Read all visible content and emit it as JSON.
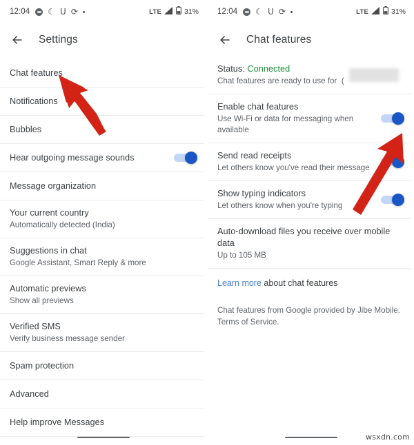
{
  "colors": {
    "accent_blue": "#1a56c4",
    "track_blue": "#c3d6f7",
    "status_green": "#1e8e3e",
    "link_blue": "#4a7fd4",
    "arrow_red": "#d32316",
    "divider": "#ebebeb",
    "text_primary": "#3c4043",
    "text_secondary": "#5f6368"
  },
  "status_bar": {
    "time": "12:04",
    "icons_left": [
      "app-badge-icon",
      "crescent-moon-icon",
      "u-glyph-icon",
      "swirl-icon",
      "dot-icon"
    ],
    "network": "LTE",
    "signal": "signal-bars-icon",
    "battery": "battery-icon",
    "battery_percent": "31%"
  },
  "left_panel": {
    "appbar": {
      "back_icon": "back-arrow-icon",
      "title": "Settings"
    },
    "items": [
      {
        "title": "Chat features",
        "sub": "",
        "toggle": null
      },
      {
        "title": "Notifications",
        "sub": "",
        "toggle": null
      },
      {
        "title": "Bubbles",
        "sub": "",
        "toggle": null
      },
      {
        "title": "Hear outgoing message sounds",
        "sub": "",
        "toggle": "on"
      },
      {
        "title": "Message organization",
        "sub": "",
        "toggle": null
      },
      {
        "title": "Your current country",
        "sub": "Automatically detected (India)",
        "toggle": null
      },
      {
        "title": "Suggestions in chat",
        "sub": "Google Assistant, Smart Reply & more",
        "toggle": null
      },
      {
        "title": "Automatic previews",
        "sub": "Show all previews",
        "toggle": null
      },
      {
        "title": "Verified SMS",
        "sub": "Verify business message sender",
        "toggle": null
      },
      {
        "title": "Spam protection",
        "sub": "",
        "toggle": null
      },
      {
        "title": "Advanced",
        "sub": "",
        "toggle": null
      },
      {
        "title": "Help improve Messages",
        "sub": "",
        "toggle": null
      }
    ]
  },
  "right_panel": {
    "appbar": {
      "back_icon": "back-arrow-icon",
      "title": "Chat features"
    },
    "status_block": {
      "label": "Status:",
      "value": "Connected",
      "description": "Chat features are ready to use for",
      "redacted": true
    },
    "items": [
      {
        "title": "Enable chat features",
        "sub": "Use Wi-Fi or data for messaging when available",
        "toggle": "on"
      },
      {
        "title": "Send read receipts",
        "sub": "Let others know you've read their message",
        "toggle": "on"
      },
      {
        "title": "Show typing indicators",
        "sub": "Let others know when you're typing",
        "toggle": "on"
      },
      {
        "title": "Auto-download files you receive over mobile data",
        "sub": "Up to 105 MB",
        "toggle": null
      }
    ],
    "learn_more": {
      "link": "Learn more",
      "rest": " about chat features"
    },
    "legal": "Chat features from Google provided by Jibe Mobile. Terms of Service."
  },
  "annotations": [
    {
      "name": "arrow-to-chat-features",
      "color": "#d32316"
    },
    {
      "name": "arrow-to-enable-toggle",
      "color": "#d32316"
    }
  ],
  "watermark": "wsxdn.com"
}
